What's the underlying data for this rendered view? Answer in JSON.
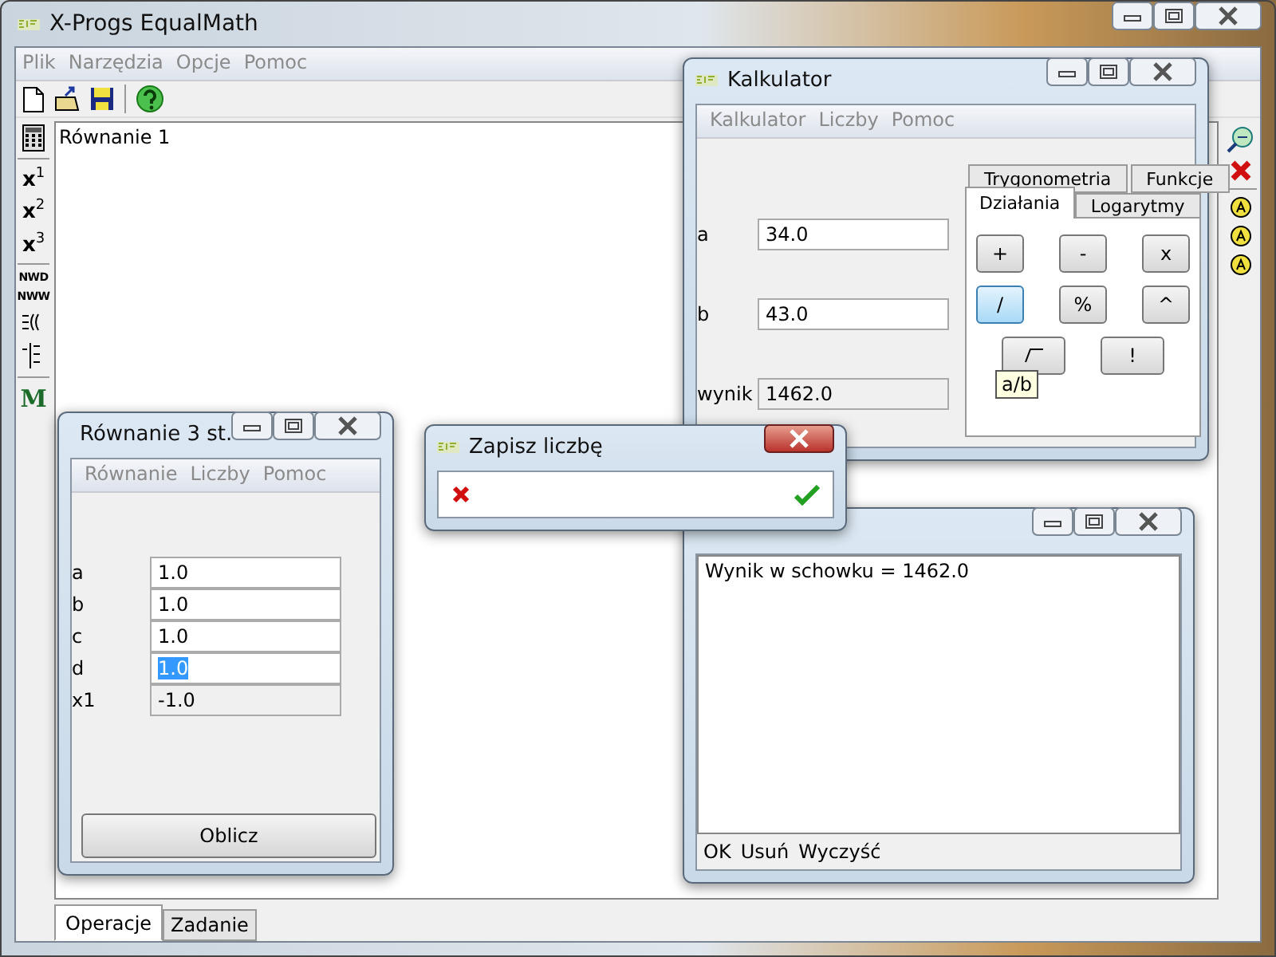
{
  "window": {
    "title": "X-Progs EqualMath"
  },
  "menu": [
    "Plik",
    "Narzędzia",
    "Opcje",
    "Pomoc"
  ],
  "left_toolbar": {
    "powers": [
      "x$^{1}$",
      "x$^{2}$",
      "x$^{3}$"
    ],
    "tools": [
      "NWD",
      "NWW"
    ],
    "logo": "M"
  },
  "document": {
    "text": "Równanie 1"
  },
  "bottom_tabs": [
    {
      "label": "Operacje",
      "selected": true
    },
    {
      "label": "Zadanie",
      "selected": false
    }
  ],
  "calculator": {
    "title": "Kalkulator",
    "menu": [
      "Kalkulator",
      "Liczby",
      "Pomoc"
    ],
    "fields": [
      {
        "label": "a",
        "value": "34.0",
        "readonly": false
      },
      {
        "label": "b",
        "value": "43.0",
        "readonly": false
      },
      {
        "label": "wynik",
        "value": "1462.0",
        "readonly": true
      }
    ],
    "tabs_back": [
      {
        "label": "Trygonometria",
        "selected": false
      },
      {
        "label": "Funkcje",
        "selected": false
      }
    ],
    "tabs_front": [
      {
        "label": "Działania",
        "selected": true
      },
      {
        "label": "Logarytmy",
        "selected": false
      }
    ],
    "buttons": [
      {
        "label": "+",
        "pressed": false
      },
      {
        "label": "-",
        "pressed": false
      },
      {
        "label": "x",
        "pressed": false
      },
      {
        "label": "/",
        "pressed": true
      },
      {
        "label": "%",
        "pressed": false
      },
      {
        "label": "^",
        "pressed": false
      },
      {
        "label": "!",
        "pressed": false
      }
    ],
    "tooltip": "a/b"
  },
  "equation": {
    "title": "Równanie 3 st.",
    "menu": [
      "Równanie",
      "Liczby",
      "Pomoc"
    ],
    "fields": [
      {
        "label": "a",
        "value": "1.0",
        "readonly": false,
        "selected": false
      },
      {
        "label": "b",
        "value": "1.0",
        "readonly": false,
        "selected": false
      },
      {
        "label": "c",
        "value": "1.0",
        "readonly": false,
        "selected": false
      },
      {
        "label": "d",
        "value": "1.0",
        "readonly": false,
        "selected": true
      },
      {
        "label": "x1",
        "value": "-1.0",
        "readonly": true,
        "selected": false
      }
    ],
    "button": "Oblicz"
  },
  "save_dialog": {
    "title": "Zapisz liczbę"
  },
  "clipboard": {
    "text": "Wynik w schowku = 1462.0",
    "actions": [
      "OK",
      "Usuń",
      "Wyczyść"
    ]
  }
}
